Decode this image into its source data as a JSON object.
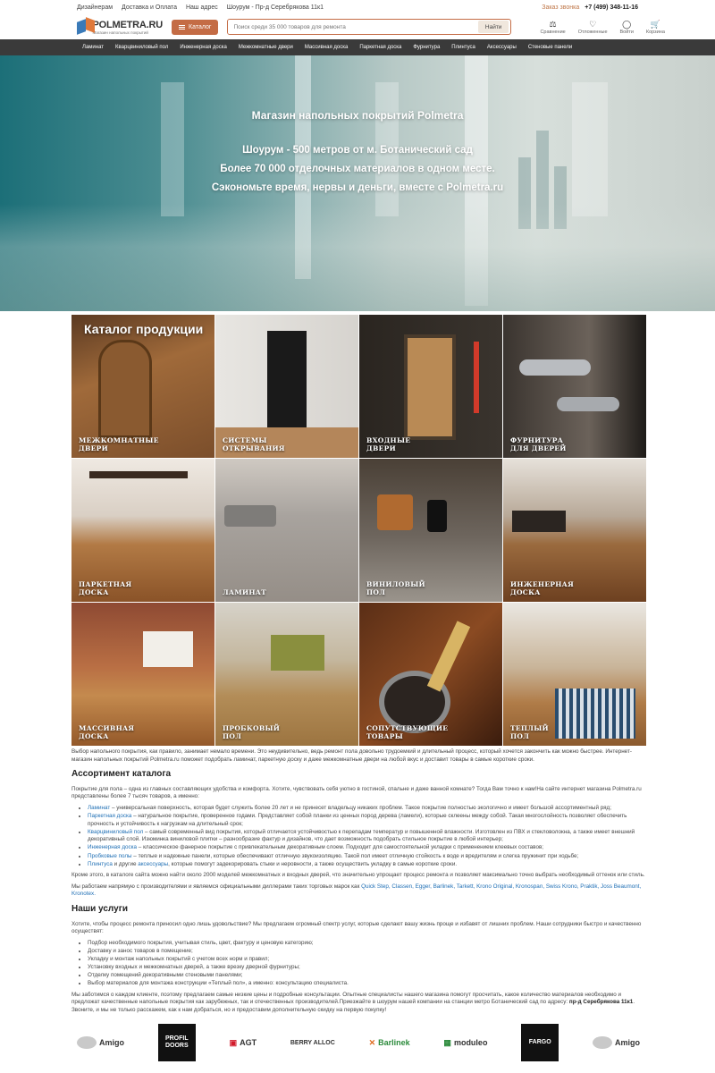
{
  "topbar": {
    "links": [
      "Дизайнерам",
      "Доставка и Оплата",
      "Наш адрес",
      "Шоурум - Пр-д Серебрякова 11к1"
    ],
    "callback": "Заказ звонка",
    "phone": "+7 (499) 348-11-16"
  },
  "header": {
    "logo_name": "POLMETRA.RU",
    "logo_tagline": "Магазин напольных покрытий",
    "catalog_label": "Каталог",
    "search_placeholder": "Поиск среди 35 000 товаров для ремонта",
    "search_button": "Найти",
    "icons": [
      {
        "name": "compare-icon",
        "label": "Сравнение",
        "glyph": "⚖"
      },
      {
        "name": "heart-icon",
        "label": "Отложенные",
        "glyph": "♡"
      },
      {
        "name": "user-icon",
        "label": "Войти",
        "glyph": "◯"
      },
      {
        "name": "cart-icon",
        "label": "Корзина",
        "glyph": "🛒"
      }
    ]
  },
  "nav": [
    "Ламинат",
    "Кварцвиниловый пол",
    "Инженерная доска",
    "Межкомнатные двери",
    "Массивная доска",
    "Паркетная доска",
    "Фурнитура",
    "Плинтуса",
    "Аксессуары",
    "Стеновые панели"
  ],
  "hero": {
    "title": "Магазин напольных покрытий Polmetra",
    "lines": [
      "Шоурум - 500 метров от м. Ботанический сад",
      "Более 70 000 отделочных материалов в одном месте.",
      "Сэкономьте время, нервы и деньги, вместе с Polmetra.ru"
    ]
  },
  "catalog": {
    "title": "Каталог продукции",
    "tiles": [
      {
        "label": "МЕЖКОМНАТНЫЕ\nДВЕРИ"
      },
      {
        "label": "СИСТЕМЫ\nОТКРЫВАНИЯ"
      },
      {
        "label": "ВХОДНЫЕ\nДВЕРИ"
      },
      {
        "label": "ФУРНИТУРА\nДЛЯ ДВЕРЕЙ"
      },
      {
        "label": "ПАРКЕТНАЯ\nДОСКА"
      },
      {
        "label": "ЛАМИНАТ"
      },
      {
        "label": "ВИНИЛОВЫЙ\nПОЛ"
      },
      {
        "label": "ИНЖЕНЕРНАЯ\nДОСКА"
      },
      {
        "label": "МАССИВНАЯ\nДОСКА"
      },
      {
        "label": "ПРОБКОВЫЙ\nПОЛ"
      },
      {
        "label": "СОПУТСТВУЮЩИЕ\nТОВАРЫ"
      },
      {
        "label": "ТЕПЛЫЙ\nПОЛ"
      }
    ]
  },
  "intro": "Выбор напольного покрытия, как правило, занимает немало времени. Это неудивительно, ведь ремонт пола довольно трудоемкий и длительный процесс, который хочется закончить как можно быстрее. Интернет-магазин напольных покрытий Polmetra.ru поможет подобрать ламинат, паркетную доску и даже межкомнатные двери на любой вкус и доставит товары в самые короткие сроки.",
  "assortment": {
    "heading": "Ассортимент каталога",
    "lead": "Покрытие для пола – одна из главных составляющих удобства и комфорта. Хотите, чувствовать себя уютно в гостиной, спальне и даже ванной комнате? Тогда Вам точно к нам!На сайте интернет магазина Polmetra.ru представлены более 7 тысяч товаров, а именно:",
    "items": [
      {
        "link": "Ламинат",
        "text": " – универсальная поверхность, которая будет служить более 20 лет и не принесет владельцу никаких проблем. Такое покрытие полностью экологично и имеет большой ассортиментный ряд;"
      },
      {
        "link": "Паркетная доска",
        "text": " – натуральное покрытие, проверенное годами. Представляет собой планки из ценных пород дерева (ламели), которые склеены между собой. Такая многослойность позволяет обеспечить прочность и устойчивость к нагрузкам на длительный срок;"
      },
      {
        "link": "Кварцвиниловый пол",
        "text": " – самый современный вид покрытия, который отличается устойчивостью к перепадам температур и повышенной влажности. Изготовлен из ПВХ и стекловолокна, а также имеет внешний декоративный слой. Изюминка виниловой плитки – разнообразие фактур и дизайнов, что дает возможность подобрать стильное покрытие в любой интерьер;"
      },
      {
        "link": "Инженерная доска",
        "text": " – классическое фанерное покрытие с привлекательным декоративным слоем. Подходит для самостоятельной укладки с применением клеевых составов;"
      },
      {
        "link": "Пробковые полы",
        "text": " – теплые и надежные панели, которые обеспечивают отличную звукоизоляцию. Такой пол имеет отличную стойкость к воде и вредителям и слегка пружинит при ходьбе;"
      },
      {
        "link": "Плинтуса",
        "text": " и другие ",
        "link2": "аксессуары",
        "text2": ", которые помогут задекорировать стыки и неровности, а также осуществить укладку в самые короткие сроки."
      }
    ],
    "after": "Кроме этого, в каталоге сайта можно найти около 2000 моделей межкомнатных и входных дверей, что значительно упрощает процесс ремонта и позволяет максимально точно выбрать необходимый оттенок или стиль.",
    "dealers_lead": "Мы работаем напрямую с производителями и являемся официальными диллерами таких торговых марок как ",
    "dealers": "Quick Step, Classen, Egger, Barlinek, Tarkett, Krono Original, Kronospan, Swiss Krono, Praktik, Joss Beaumont, Kronotex."
  },
  "services": {
    "heading": "Наши услуги",
    "lead": "Хотите, чтобы процесс ремонта приносил одно лишь удовольствие? Мы предлагаем огромный спектр услуг, которые сделают вашу жизнь проще и избавят от лишних проблем. Наши сотрудники быстро и качественно осуществят:",
    "items": [
      "Подбор необходимого покрытия, учитывая стиль, цвет, фактуру и ценовую категорию;",
      "Доставку и занос товаров в помещение;",
      "Укладку и монтаж напольных покрытий с учетом всех норм и правил;",
      "Установку входных и межкомнатных дверей, а также врезку дверной фурнитуры;",
      "Отделку помещений декоративными стеновыми панелями;",
      "Выбор материалов для монтажа конструкции «Теплый пол», а именно: консультацию специалиста."
    ],
    "closing": "Мы заботимся о каждом клиенте, поэтому предлагаем самые низкие цены и подробные консультации. Опытные специалисты нашего магазина помогут просчитать, какое количество материалов необходимо и предложат качественные напольные покрытия как зарубежных, так и отечественных производителей.Приезжайте в шоурум нашей компании на станции метро Ботанический сад по адресу: ",
    "address": "пр-д Серебрякова 11к1",
    "closing2": ". Звоните, и мы не только расскажем, как к нам добраться, но и предоставим дополнительную скидку на первую покупку!"
  },
  "brands": [
    "Amigo",
    "PROFIL DOORS",
    "AGT",
    "BERRY ALLOC",
    "Barlinek",
    "moduleo",
    "FARGO",
    "Amigo"
  ]
}
